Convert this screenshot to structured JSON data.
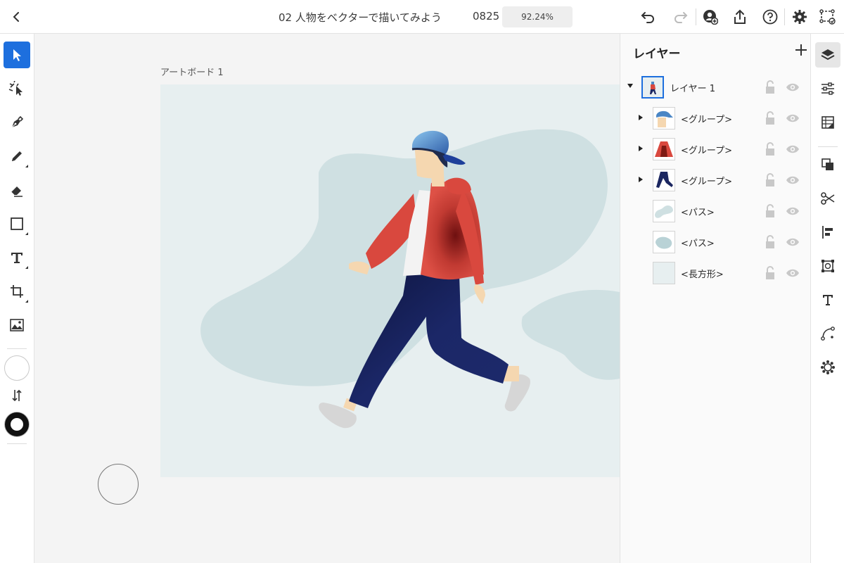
{
  "header": {
    "title": "02 人物をベクターで描いてみよう",
    "version": "0825",
    "zoom": "92.24%"
  },
  "toolbar_left": {
    "tools": [
      "select-tool",
      "direct-select-tool",
      "pen-tool",
      "pencil-tool",
      "eraser-tool",
      "rectangle-tool",
      "text-tool",
      "transform-tool",
      "image-tool"
    ],
    "active_tool": "select-tool",
    "fill_color": "#ffffff",
    "stroke_color": "#111111"
  },
  "canvas": {
    "artboard_label": "アートボード 1",
    "background_color": "#e7eff0",
    "blob_color": "#cfe0e2"
  },
  "layers_panel": {
    "title": "レイヤー",
    "items": [
      {
        "name": "レイヤー 1",
        "level": 0,
        "expanded": true,
        "thumb": "figure"
      },
      {
        "name": "<グループ>",
        "level": 1,
        "expanded": false,
        "thumb": "cap"
      },
      {
        "name": "<グループ>",
        "level": 1,
        "expanded": false,
        "thumb": "jacket"
      },
      {
        "name": "<グループ>",
        "level": 1,
        "expanded": false,
        "thumb": "pants"
      },
      {
        "name": "<パス>",
        "level": 1,
        "expanded": null,
        "thumb": "blob-small"
      },
      {
        "name": "<パス>",
        "level": 1,
        "expanded": null,
        "thumb": "blob-large"
      },
      {
        "name": "<長方形>",
        "level": 1,
        "expanded": null,
        "thumb": "rectangle"
      }
    ]
  },
  "toolbar_right": {
    "icons": [
      "layers-icon",
      "properties-icon",
      "libraries-icon",
      "pathfinder-icon",
      "scissors-icon",
      "align-icon",
      "transform-box-icon",
      "type-icon",
      "curve-icon",
      "settings-cog-icon"
    ],
    "active_icon": "layers-icon"
  },
  "colors": {
    "accent": "#1d6fde",
    "jacket": "#d9483e",
    "pants": "#1b2660",
    "cap": "#4a86c5",
    "skin": "#f5d7b0",
    "shoe": "#d7d7d7"
  }
}
